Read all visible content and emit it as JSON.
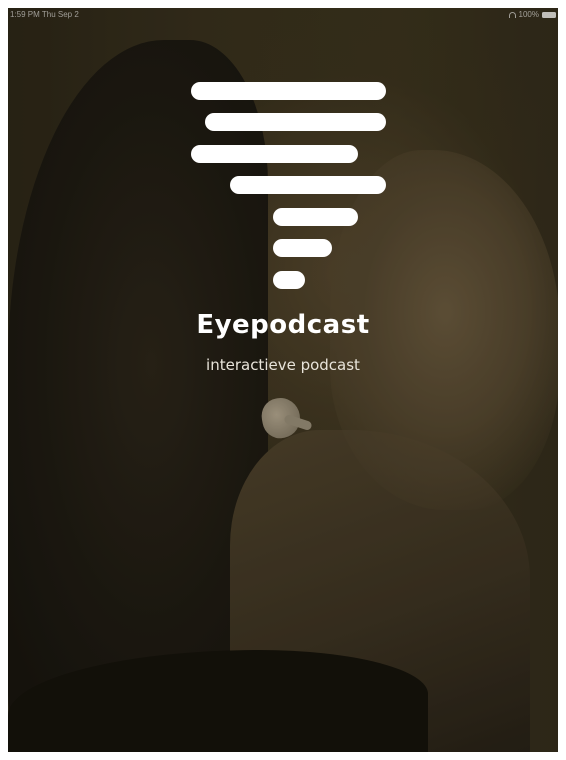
{
  "status_bar": {
    "time": "1:59 PM   Thu Sep 2",
    "battery": "100%"
  },
  "splash": {
    "title": "Eyepodcast",
    "subtitle": "interactieve podcast",
    "logo_icon": "stacked-bars-logo-icon"
  },
  "colors": {
    "logo": "#ffffff",
    "overlay": "#2f2a1a"
  }
}
